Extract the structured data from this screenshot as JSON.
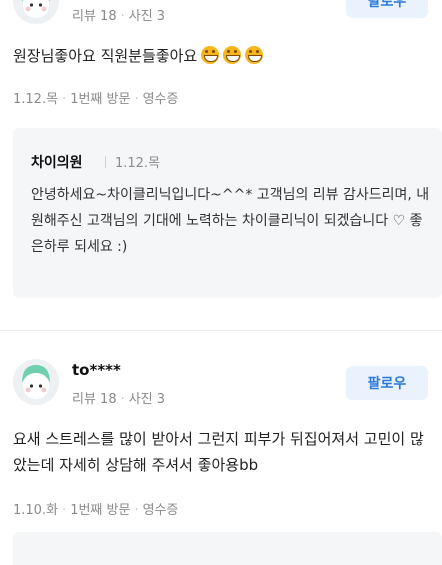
{
  "reviews": [
    {
      "nickname": "",
      "review_count": "리뷰 18",
      "photo_count": "사진 3",
      "follow_label": "팔로우",
      "text": "원장님좋아요 직원분들좋아요",
      "emojis": [
        "grinning-face-emoji",
        "grinning-face-emoji",
        "grinning-face-emoji"
      ],
      "date": "1.12.목",
      "visit": "1번째 방문",
      "receipt": "영수증",
      "reply": {
        "owner": "차이의원",
        "date": "1.12.목",
        "text": "안녕하세요~차이클리닉입니다~^^* 고객님의 리뷰 감사드리며, 내원해주신 고객님의 기대에 노력하는 차이클리닉이 되겠습니다 ♡ 좋은하루 되세요 :)"
      }
    },
    {
      "nickname": "to****",
      "review_count": "리뷰 18",
      "photo_count": "사진 3",
      "follow_label": "팔로우",
      "text": "요새 스트레스를 많이 받아서 그런지 피부가 뒤집어져서 고민이 많았는데 자세히 상담해 주셔서 좋아용bb",
      "date": "1.10.화",
      "visit": "1번째 방문",
      "receipt": "영수증"
    }
  ],
  "colors": {
    "accent": "#2c7ad6",
    "follow_bg": "#eaf3fd",
    "reply_bg": "#f5f6f8",
    "meta_text": "#8b8b8b"
  }
}
